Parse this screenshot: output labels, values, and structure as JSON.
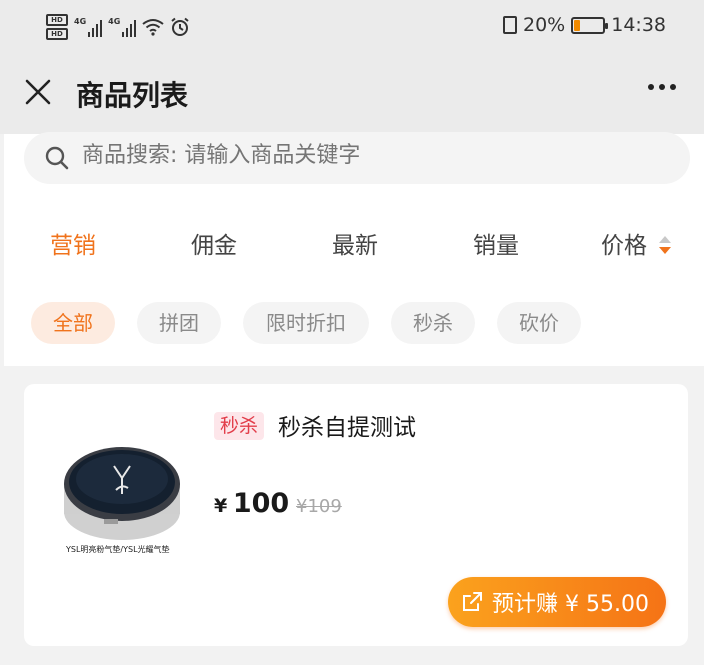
{
  "status_bar": {
    "signal_1": "4G",
    "signal_2": "4G",
    "battery_percent": "20%",
    "battery_level": 0.2,
    "time": "14:38",
    "icons": [
      "hd-icon",
      "signal-icon",
      "wifi-icon",
      "alarm-icon",
      "vibrate-icon",
      "battery-icon"
    ]
  },
  "header": {
    "title": "商品列表",
    "close_icon": "close-icon",
    "more_icon": "more-icon"
  },
  "search": {
    "placeholder": "商品搜索: 请输入商品关键字"
  },
  "sort_tabs": [
    {
      "label": "营销",
      "active": true
    },
    {
      "label": "佣金",
      "active": false
    },
    {
      "label": "最新",
      "active": false
    },
    {
      "label": "销量",
      "active": false
    },
    {
      "label": "价格",
      "active": false
    }
  ],
  "filter_chips": [
    {
      "label": "全部",
      "active": true
    },
    {
      "label": "拼团",
      "active": false
    },
    {
      "label": "限时折扣",
      "active": false
    },
    {
      "label": "秒杀",
      "active": false
    },
    {
      "label": "砍价",
      "active": false
    }
  ],
  "product": {
    "tag": "秒杀",
    "name": "秒杀自提测试",
    "currency": "¥",
    "price": "100",
    "original_price": "¥109",
    "image_caption": "YSL明亮粉气垫/YSL光耀气垫",
    "earn_label": "预计赚 ¥ 55.00"
  },
  "colors": {
    "accent": "#f0731c",
    "tag_text": "#e23d4a",
    "button_start": "#fba21d",
    "button_end": "#f57316"
  }
}
